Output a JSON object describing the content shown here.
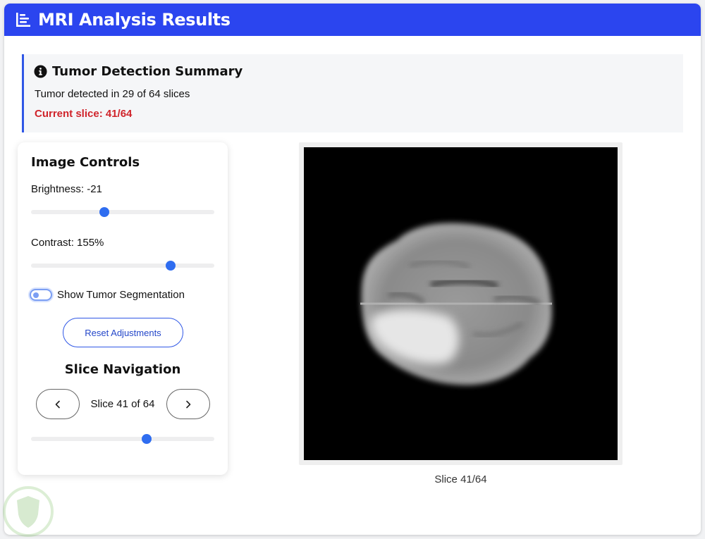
{
  "header": {
    "title": "MRI Analysis Results",
    "icon": "bar-chart-icon"
  },
  "summary": {
    "icon": "info-icon",
    "title": "Tumor Detection Summary",
    "text": "Tumor detected in 29 of 64 slices",
    "current_slice": "Current slice: 41/64",
    "accent_color": "#2f57e6",
    "alert_color": "#d0242b"
  },
  "controls": {
    "title": "Image Controls",
    "brightness_label": "Brightness: -21",
    "brightness_value": -21,
    "brightness_fraction": 0.4,
    "contrast_label": "Contrast: 155%",
    "contrast_value": 155,
    "contrast_fraction": 0.76,
    "toggle_label": "Show Tumor Segmentation",
    "toggle_on": false,
    "reset_label": "Reset Adjustments"
  },
  "navigation": {
    "title": "Slice Navigation",
    "indicator": "Slice 41 of 64",
    "current": 41,
    "total": 64,
    "slider_fraction": 0.63,
    "prev_icon": "chevron-left-icon",
    "next_icon": "chevron-right-icon"
  },
  "viewer": {
    "caption": "Slice 41/64"
  },
  "theme": {
    "primary": "#2b45ef",
    "thumb": "#2f6df0"
  }
}
